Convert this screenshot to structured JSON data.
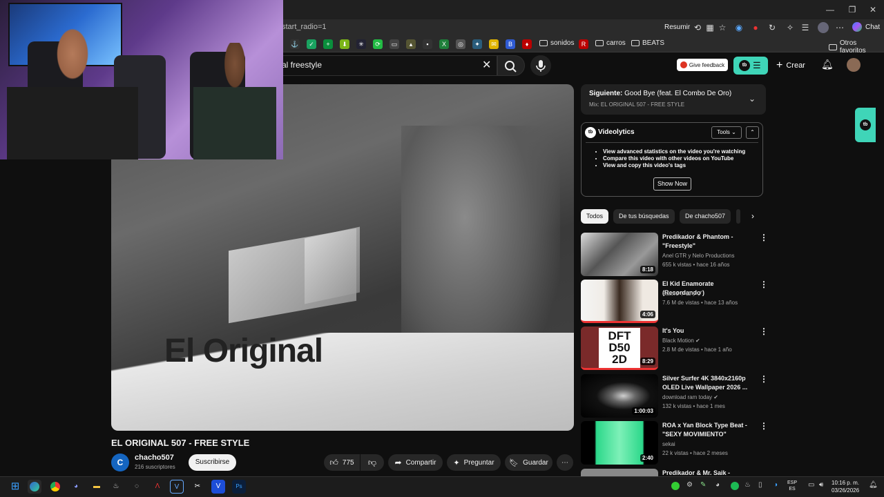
{
  "browser": {
    "url_fragment": "start_radio=1",
    "toolbar": {
      "summarize_label": "Resumir",
      "chat_label": "Chat"
    },
    "bookmarks": {
      "folder1": "sonidos",
      "folder2": "carros",
      "folder3": "BEATS",
      "other": "Otros favoritos"
    }
  },
  "header": {
    "search_query": "al freestyle",
    "feedback_label": "Give feedback",
    "create_label": "Crear"
  },
  "video": {
    "overlay_text": "El Original",
    "title": "EL ORIGINAL 507 - FREE STYLE",
    "channel": {
      "avatar_letter": "C",
      "name": "chacho507",
      "subscribers": "216 suscriptores"
    },
    "subscribe_label": "Suscribirse",
    "likes": "775",
    "share_label": "Compartir",
    "ask_label": "Preguntar",
    "save_label": "Guardar"
  },
  "up_next": {
    "prefix": "Siguiente:",
    "title": "Good Bye (feat. El Combo De Oro)",
    "mix": "Mix: EL ORIGINAL 507 - FREE STYLE"
  },
  "videolytics": {
    "logo_text": "tb",
    "title": "Videolytics",
    "tools_label": "Tools",
    "bullets": [
      "View advanced statistics on the video you're watching",
      "Compare this video with other videos on YouTube",
      "View and copy this video's tags"
    ],
    "show_now_label": "Show Now"
  },
  "chips": [
    "Todos",
    "De tus búsquedas",
    "De chacho507"
  ],
  "recommendations": [
    {
      "title_line1": "Predikador & Phantom -",
      "title_line2": "\"Freestyle\"",
      "channel": "Anel GTR y Nelo Productions",
      "meta": "655 k vistas • hace 16 años",
      "duration": "8:18"
    },
    {
      "title_line1": "El Kid Enamorate (Recordando )",
      "title_line2": "",
      "channel": "Satoru ドロップ",
      "meta": "7.6 M de vistas • hace 13 años",
      "duration": "4:06"
    },
    {
      "title_line1": "It's You",
      "title_line2": "",
      "channel": "Black Motion",
      "meta": "2.8 M de vistas • hace 1 año",
      "duration": "8:29"
    },
    {
      "title_line1": "Silver Surfer 4K 3840x2160p",
      "title_line2": "OLED Live Wallpaper 2026 ...",
      "channel": "download ram today",
      "meta": "132 k vistas • hace 1 mes",
      "duration": "1:00:03"
    },
    {
      "title_line1": "ROA x Yan Block Type Beat -",
      "title_line2": "\"SEXY MOVIMIENTO\"",
      "channel": "sekai",
      "meta": "22 k vistas • hace 2 meses",
      "duration": "2:40"
    },
    {
      "title_line1": "Predikador & Mr. Saik -",
      "title_line2": "",
      "channel": "",
      "meta": "",
      "duration": ""
    }
  ],
  "taskbar": {
    "lang_line1": "ESP",
    "lang_line2": "ES",
    "time": "10:16 p. m.",
    "date": "03/26/2026"
  },
  "colors": {
    "accent_teal": "#3fd5b8",
    "youtube_bg": "#0f0f0f",
    "chip_active": "#f1f1f1"
  }
}
